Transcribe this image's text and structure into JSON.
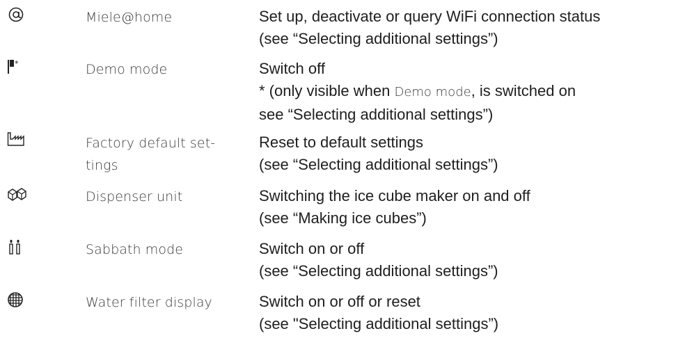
{
  "rows": [
    {
      "icon": "at-sign-icon",
      "name_lines": [
        "Miele@home"
      ],
      "desc_lines": [
        "Set up, deactivate or query WiFi connection status",
        "(see “Selecting additional settings”)"
      ]
    },
    {
      "icon": "flag-asterisk-icon",
      "name_lines": [
        "Demo mode"
      ],
      "desc_lines": [
        "Switch off"
      ],
      "desc_line2_prefix": "* (only visible when ",
      "desc_line2_inline": "Demo mode",
      "desc_line2_suffix": ", is switched on",
      "desc_line3": "see “Selecting additional settings”)"
    },
    {
      "icon": "factory-icon",
      "name_lines": [
        "Factory default set-",
        "tings"
      ],
      "desc_lines": [
        "Reset to default settings",
        "(see “Selecting additional settings”)"
      ]
    },
    {
      "icon": "ice-cubes-icon",
      "name_lines": [
        "Dispenser unit"
      ],
      "desc_lines": [
        "Switching the ice cube maker on and off",
        "(see “Making ice cubes”)"
      ]
    },
    {
      "icon": "candles-icon",
      "name_lines": [
        "Sabbath mode"
      ],
      "desc_lines": [
        "Switch on or off",
        "(see “Selecting additional settings”)"
      ]
    },
    {
      "icon": "water-filter-icon",
      "name_lines": [
        "Water filter display"
      ],
      "desc_lines": [
        "Switch on or off or reset",
        "(see \"Selecting additional settings”)"
      ]
    }
  ]
}
